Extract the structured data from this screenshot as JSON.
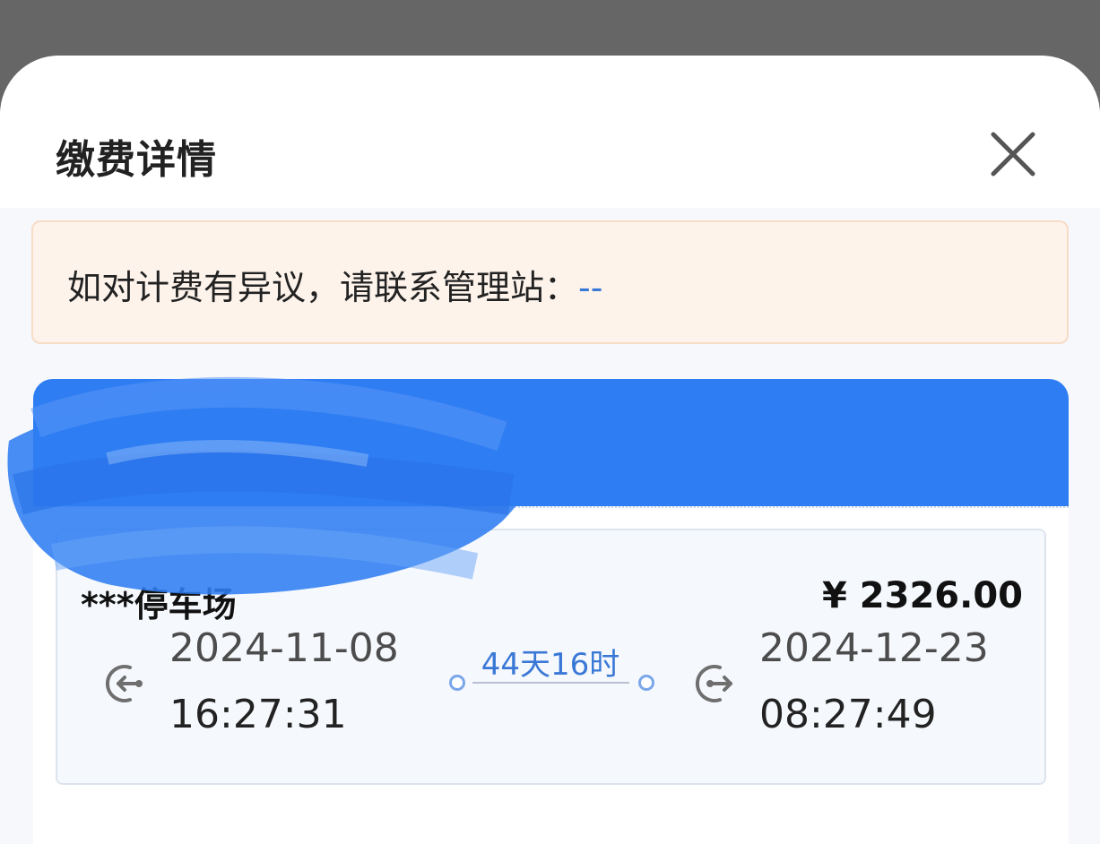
{
  "dialog": {
    "title": "缴费详情"
  },
  "notice": {
    "text": "如对计费有异议，请联系管理站：",
    "contact": "--"
  },
  "fee": {
    "parking_lot": "***停车场",
    "amount": "¥  2326.00",
    "entry_date": "2024-11-08",
    "entry_time": "16:27:31",
    "duration": "44天16时",
    "exit_date": "2024-12-23",
    "exit_time": "08:27:49"
  },
  "colors": {
    "accent": "#2f7df3",
    "link": "#3a78d6",
    "notice_bg": "#fdf3eb"
  },
  "icons": {
    "close": "close-icon",
    "entry": "entry-icon",
    "exit": "exit-icon"
  }
}
